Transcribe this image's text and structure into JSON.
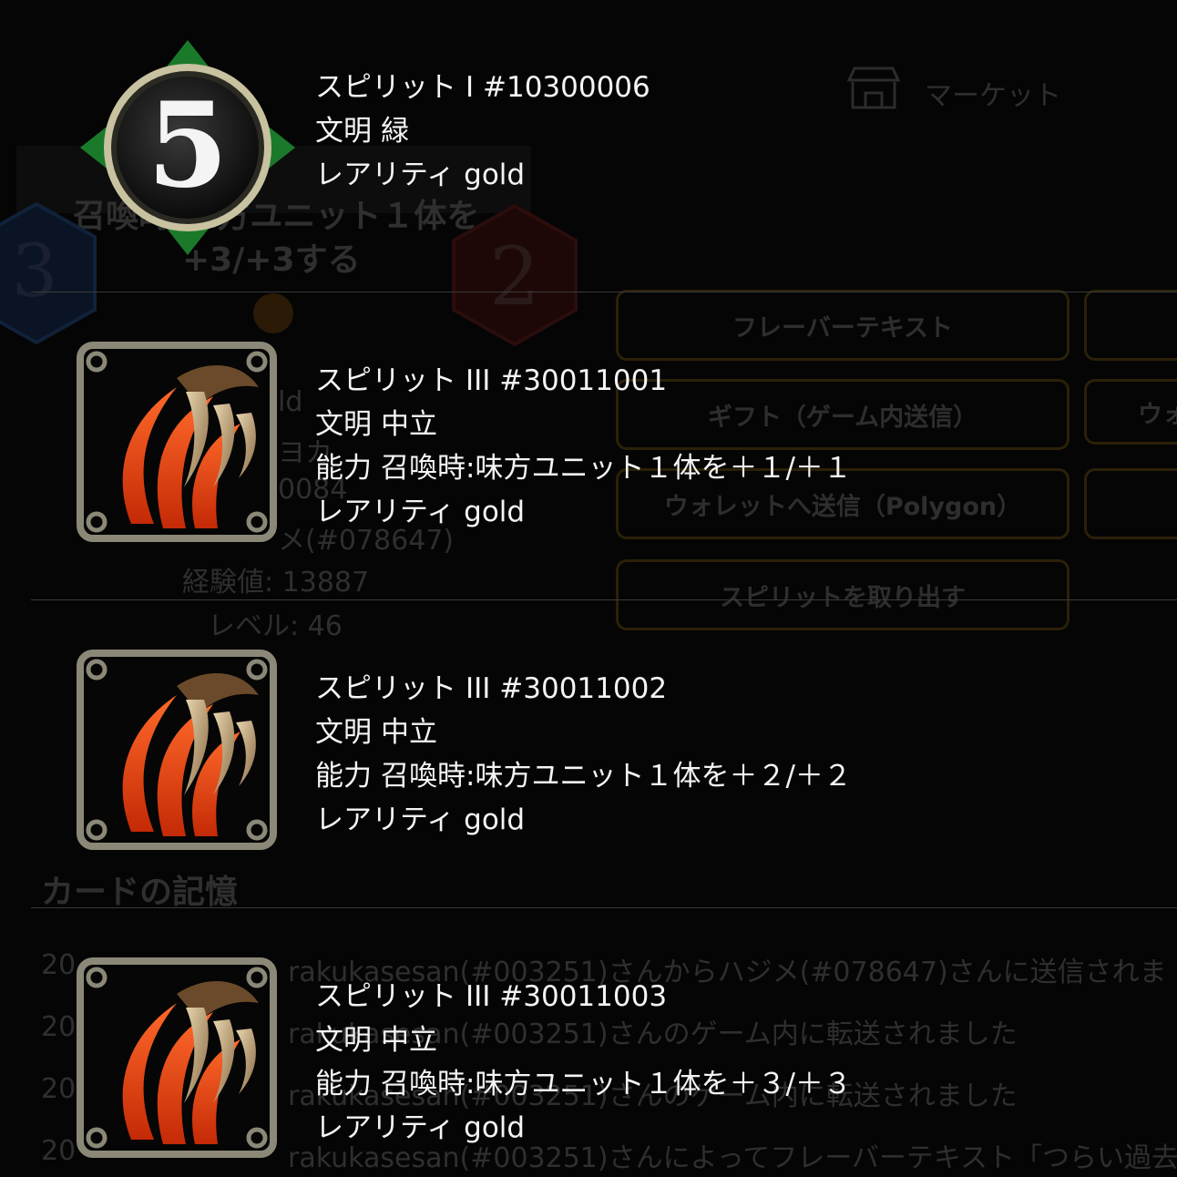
{
  "background": {
    "nav_market": "マーケット",
    "banner_text_1": "召喚時:味方ユニット１体を",
    "banner_text_2": "+3/+3する",
    "cost_left": "3",
    "cost_right": "2",
    "buttons": [
      "フレーバーテキスト",
      "ギフト（ゲーム内送信）",
      "ウォレットへ送信（Polygon）",
      "スピリットを取り出す"
    ],
    "side_buttons": [
      "",
      "ウォ",
      ""
    ],
    "owner_partial": [
      "ld",
      "ヨカ",
      "0084",
      "メ(#078647)"
    ],
    "exp": "経験値: 13887",
    "level": "レベル: 46",
    "section_title": "カードの記憶",
    "history": [
      {
        "date": "20",
        "text": "rakukasesan(#003251)さんからハジメ(#078647)さんに送信されま"
      },
      {
        "date": "20",
        "text": "rakukasesan(#003251)さんのゲーム内に転送されました"
      },
      {
        "date": "20",
        "text": "rakukasesan(#003251)さんのゲーム内に転送されました"
      },
      {
        "date": "20",
        "text": "rakukasesan(#003251)さんによってフレーバーテキスト「つらい過去"
      }
    ]
  },
  "spirits": [
    {
      "icon": "cost-5-medallion-icon",
      "cost_number": "5",
      "name_label": "スピリット",
      "name_value": "I #10300006",
      "civ_label": "文明",
      "civ_value": "緑",
      "ability_label": "",
      "ability_value": "",
      "rarity_label": "レアリティ",
      "rarity_value": "gold"
    },
    {
      "icon": "claw-icon",
      "name_label": "スピリット",
      "name_value": "III #30011001",
      "civ_label": "文明",
      "civ_value": "中立",
      "ability_label": "能力",
      "ability_value": "召喚時:味方ユニット１体を＋１/＋１",
      "rarity_label": "レアリティ",
      "rarity_value": "gold"
    },
    {
      "icon": "claw-icon",
      "name_label": "スピリット",
      "name_value": "III #30011002",
      "civ_label": "文明",
      "civ_value": "中立",
      "ability_label": "能力",
      "ability_value": "召喚時:味方ユニット１体を＋２/＋２",
      "rarity_label": "レアリティ",
      "rarity_value": "gold"
    },
    {
      "icon": "claw-icon",
      "name_label": "スピリット",
      "name_value": "III #30011003",
      "civ_label": "文明",
      "civ_value": "中立",
      "ability_label": "能力",
      "ability_value": "召喚時:味方ユニット１体を＋３/＋３",
      "rarity_label": "レアリティ",
      "rarity_value": "gold"
    }
  ]
}
